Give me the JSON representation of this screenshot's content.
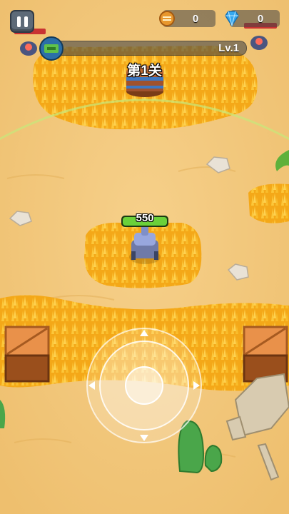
{
  "hud": {
    "pause_icon": "pause-icon",
    "coins": "0",
    "coin_icon": "coin-icon",
    "gems": "0",
    "gem_icon": "diamond-icon",
    "level": "Lv.1",
    "xp_progress": 0.0
  },
  "stage": {
    "label": "第1关"
  },
  "player": {
    "hp": "550",
    "hp_fraction": 1.0
  },
  "joystick": {
    "visible": true
  },
  "colors": {
    "sand": "#f3c77c",
    "wheat": "#f5b21c",
    "hp_green": "#6bd13a",
    "gem_blue": "#35a8f0",
    "crate": "#e08a3c"
  }
}
